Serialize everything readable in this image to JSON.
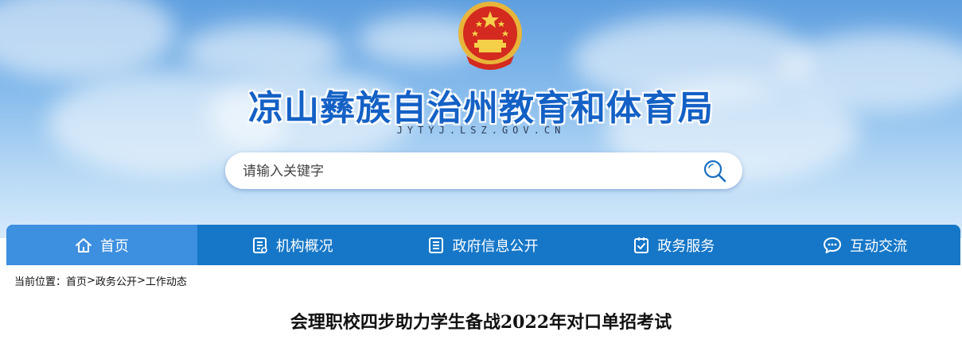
{
  "site": {
    "title": "凉山彝族自治州教育和体育局",
    "domain": "JYTYJ.LSZ.GOV.CN"
  },
  "search": {
    "placeholder": "请输入关键字"
  },
  "nav": {
    "items": [
      {
        "label": "首页",
        "icon": "home-icon",
        "active": true
      },
      {
        "label": "机构概况",
        "icon": "document-list-icon"
      },
      {
        "label": "政府信息公开",
        "icon": "file-icon"
      },
      {
        "label": "政务服务",
        "icon": "checklist-icon"
      },
      {
        "label": "互动交流",
        "icon": "chat-icon"
      }
    ]
  },
  "breadcrumb": {
    "label": "当前位置：",
    "items": [
      "首页",
      "政务公开",
      "工作动态"
    ],
    "separator": ">"
  },
  "article": {
    "title": "会理职校四步助力学生备战2022年对口单招考试"
  },
  "colors": {
    "nav_bg": "#1677c8",
    "nav_active_bg": "#3d8fe0",
    "title_blue": "#1461c6"
  }
}
